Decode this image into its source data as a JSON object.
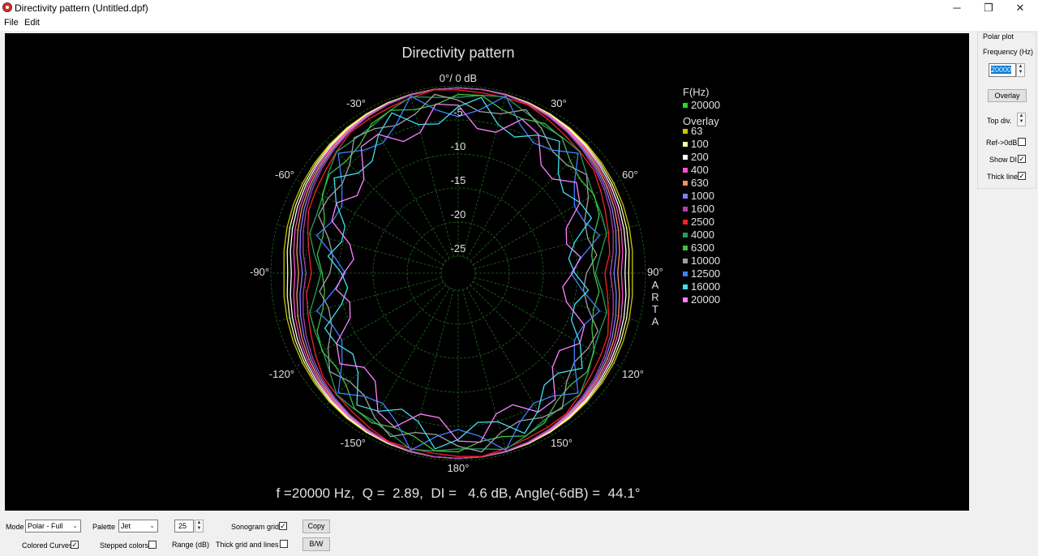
{
  "window": {
    "title": "Directivity pattern (Untitled.dpf)",
    "minimize_glyph": "─",
    "restore_glyph": "❐",
    "close_glyph": "✕"
  },
  "menu": {
    "file": "File",
    "edit": "Edit"
  },
  "plot": {
    "title": "Directivity pattern",
    "top_label": "0°/ 0 dB",
    "db_labels": [
      "-5",
      "-10",
      "-15",
      "-20",
      "-25"
    ],
    "angle_labels": {
      "m30": "-30°",
      "p30": "30°",
      "m60": "-60°",
      "p60": "60°",
      "m90": "-90°",
      "p90": "90°",
      "m120": "-120°",
      "p120": "120°",
      "m150": "-150°",
      "p150": "150°",
      "a180": "180°"
    },
    "watermark": [
      "A",
      "R",
      "T",
      "A"
    ],
    "summary": "f =20000 Hz,  Q =  2.89,  DI =   4.6 dB, Angle(-6dB) =  44.1°",
    "legend_header": "F(Hz)",
    "legend_current": "20000",
    "legend_current_color": "#22dd22",
    "legend_overlay_header": "Overlay",
    "legend_overlay": [
      {
        "label": "63",
        "color": "#c8c800"
      },
      {
        "label": "100",
        "color": "#ffffa0"
      },
      {
        "label": "200",
        "color": "#ffffff"
      },
      {
        "label": "400",
        "color": "#ff50d0"
      },
      {
        "label": "630",
        "color": "#ff9060"
      },
      {
        "label": "1000",
        "color": "#8080ff"
      },
      {
        "label": "1600",
        "color": "#b040b0"
      },
      {
        "label": "2500",
        "color": "#ff2020"
      },
      {
        "label": "4000",
        "color": "#20a060"
      },
      {
        "label": "6300",
        "color": "#40c040"
      },
      {
        "label": "10000",
        "color": "#a0a0a0"
      },
      {
        "label": "12500",
        "color": "#4080ff"
      },
      {
        "label": "16000",
        "color": "#40e0f0"
      },
      {
        "label": "20000",
        "color": "#ff80ff"
      }
    ]
  },
  "side_panel": {
    "group_label": "Polar plot",
    "frequency_label": "Frequency (Hz)",
    "frequency_value": "20000",
    "overlay_button": "Overlay",
    "top_div_label": "Top div.",
    "ref_label": "Ref->0dB",
    "ref_checked": "",
    "show_di_label": "Show DI",
    "show_di_checked": "✓",
    "thick_line_label": "Thick line",
    "thick_line_checked": "✓"
  },
  "bottom": {
    "mode_label": "Mode",
    "mode_value": "Polar - Full",
    "palette_label": "Palette",
    "palette_value": "Jet",
    "range_value": "25",
    "range_label": "Range (dB)",
    "sonogram_label": "Sonogram grid",
    "sonogram_checked": "✓",
    "copy_button": "Copy",
    "colored_curves_label": "Colored Curves",
    "colored_curves_checked": "✓",
    "stepped_colors_label": "Stepped colors",
    "stepped_colors_checked": "",
    "thick_grid_label": "Thick grid and  lines",
    "thick_grid_checked": "",
    "bw_button": "B/W"
  }
}
